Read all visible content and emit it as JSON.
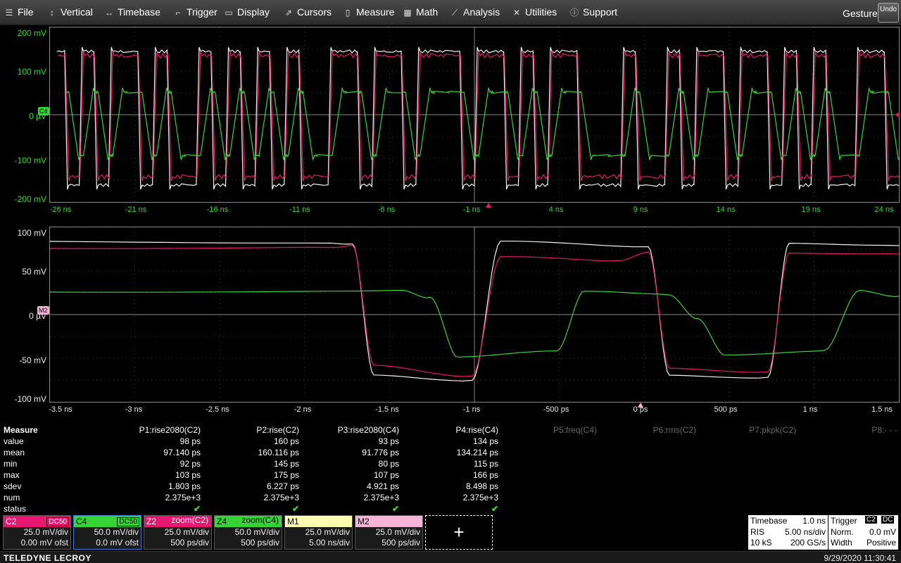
{
  "menubar": {
    "items": [
      {
        "label": "File",
        "icon": "file-icon",
        "glyph": "☰"
      },
      {
        "label": "Vertical",
        "icon": "vertical-icon",
        "glyph": "↕"
      },
      {
        "label": "Timebase",
        "icon": "timebase-icon",
        "glyph": "↔"
      },
      {
        "label": "Trigger",
        "icon": "trigger-icon",
        "glyph": "⌐"
      },
      {
        "label": "Display",
        "icon": "display-icon",
        "glyph": "▭"
      },
      {
        "label": "Cursors",
        "icon": "cursors-icon",
        "glyph": "⇗"
      },
      {
        "label": "Measure",
        "icon": "measure-icon",
        "glyph": "▯"
      },
      {
        "label": "Math",
        "icon": "math-icon",
        "glyph": "▦"
      },
      {
        "label": "Analysis",
        "icon": "analysis-icon",
        "glyph": "⟋"
      },
      {
        "label": "Utilities",
        "icon": "utilities-icon",
        "glyph": "✕"
      },
      {
        "label": "Support",
        "icon": "support-icon",
        "glyph": "ⓘ"
      }
    ],
    "gesture": "Gesture",
    "undo": "Undo"
  },
  "top_grid": {
    "y_labels": [
      "200 mV",
      "100 mV",
      "0 µV",
      "-100 mV",
      "-200 mV"
    ],
    "x_labels": [
      "-26 ns",
      "-21 ns",
      "-16 ns",
      "-11 ns",
      "-6 ns",
      "-1 ns",
      "4 ns",
      "9 ns",
      "14 ns",
      "19 ns",
      "24 ns"
    ],
    "trace_tag": "C4"
  },
  "bottom_grid": {
    "y_labels": [
      "100 mV",
      "50 mV",
      "0 µV",
      "-50 mV",
      "-100 mV"
    ],
    "x_labels": [
      "-3.5 ns",
      "-3 ns",
      "-2.5 ns",
      "-2 ns",
      "-1.5 ns",
      "-1 ns",
      "-500 ps",
      "0 ps",
      "500 ps",
      "1 ns",
      "1.5 ns"
    ],
    "trace_tag": "M2"
  },
  "colors": {
    "c2": "#e8166e",
    "c4": "#35d435",
    "z2": "#e8166e",
    "m1": "#fdfdb0",
    "m2": "#f8b4d6",
    "white": "#f4f4f4",
    "grid": "#2fdc2f"
  },
  "measure": {
    "title": "Measure",
    "params": [
      "P1:rise2080(C2)",
      "P2:rise(C2)",
      "P3:rise2080(C4)",
      "P4:rise(C4)",
      "P5:freq(C4)",
      "P6:rms(C2)",
      "P7:pkpk(C2)",
      "P8:- - -"
    ],
    "rows": [
      {
        "label": "value",
        "cells": [
          "98 ps",
          "160 ps",
          "93 ps",
          "134 ps"
        ]
      },
      {
        "label": "mean",
        "cells": [
          "97.140 ps",
          "160.116 ps",
          "91.776 ps",
          "134.214 ps"
        ]
      },
      {
        "label": "min",
        "cells": [
          "92 ps",
          "145 ps",
          "80 ps",
          "115 ps"
        ]
      },
      {
        "label": "max",
        "cells": [
          "103 ps",
          "175 ps",
          "107 ps",
          "166 ps"
        ]
      },
      {
        "label": "sdev",
        "cells": [
          "1.803 ps",
          "6.227 ps",
          "4.921 ps",
          "8.498 ps"
        ]
      },
      {
        "label": "num",
        "cells": [
          "2.375e+3",
          "2.375e+3",
          "2.375e+3",
          "2.375e+3"
        ]
      },
      {
        "label": "status",
        "cells": [
          "✔",
          "✔",
          "✔",
          "✔"
        ]
      }
    ]
  },
  "channels": [
    {
      "name": "C2",
      "badge": "DC50",
      "line1": "25.0 mV/div",
      "line2": "0.00 mV ofst",
      "color": "#e8166e"
    },
    {
      "name": "C4",
      "badge": "DC50",
      "line1": "50.0 mV/div",
      "line2": "0.0 mV ofst",
      "color": "#35d435"
    },
    {
      "name": "Z2",
      "badge": "zoom(C2)",
      "line1": "25.0 mV/div",
      "line2": "500 ps/div",
      "color": "#e8166e"
    },
    {
      "name": "Z4",
      "badge": "zoom(C4)",
      "line1": "50.0 mV/div",
      "line2": "500 ps/div",
      "color": "#35d435"
    },
    {
      "name": "M1",
      "badge": "",
      "line1": "25.0 mV/div",
      "line2": "5.00 ns/div",
      "color": "#fdfdb0"
    },
    {
      "name": "M2",
      "badge": "",
      "line1": "25.0 mV/div",
      "line2": "500 ps/div",
      "color": "#f8b4d6"
    }
  ],
  "add_button": "+",
  "timebase": {
    "title": "Timebase",
    "delay": "1.0 ns",
    "mode": "RIS",
    "rate": "5.00 ns/div",
    "points": "10 kS",
    "sample_rate": "200 GS/s"
  },
  "trigger": {
    "title": "Trigger",
    "src1": "C2",
    "src2": "DC",
    "mode": "Norm.",
    "level": "0.0 mV",
    "type": "Width",
    "slope": "Positive"
  },
  "footer": {
    "brand": "TELEDYNE LECROY",
    "datetime": "9/29/2020 11:30:41"
  }
}
